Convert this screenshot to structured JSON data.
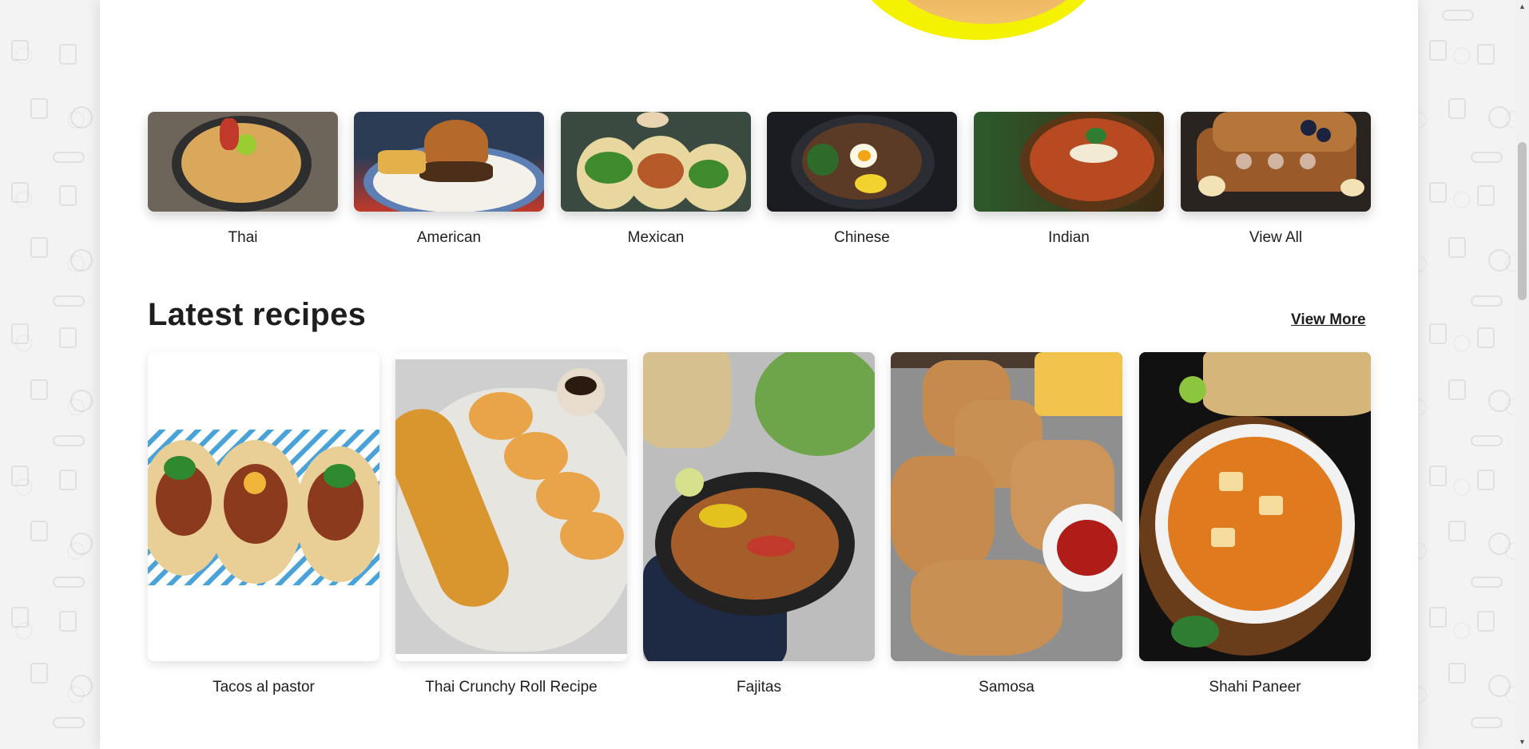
{
  "categories": [
    {
      "label": "Thai",
      "icon": "thai-dish-image"
    },
    {
      "label": "American",
      "icon": "burger-image"
    },
    {
      "label": "Mexican",
      "icon": "tacos-image"
    },
    {
      "label": "Chinese",
      "icon": "ramen-bowl-image"
    },
    {
      "label": "Indian",
      "icon": "curry-bowl-image"
    },
    {
      "label": "View All",
      "icon": "french-toast-image"
    }
  ],
  "latest": {
    "title": "Latest recipes",
    "view_more": "View More",
    "recipes": [
      {
        "title": "Tacos al pastor"
      },
      {
        "title": "Thai Crunchy Roll Recipe"
      },
      {
        "title": "Fajitas"
      },
      {
        "title": "Samosa"
      },
      {
        "title": "Shahi Paneer"
      }
    ]
  },
  "colors": {
    "accent_yellow": "#f4f200",
    "text": "#1e1e1e",
    "page_bg": "#f3f3f3"
  }
}
